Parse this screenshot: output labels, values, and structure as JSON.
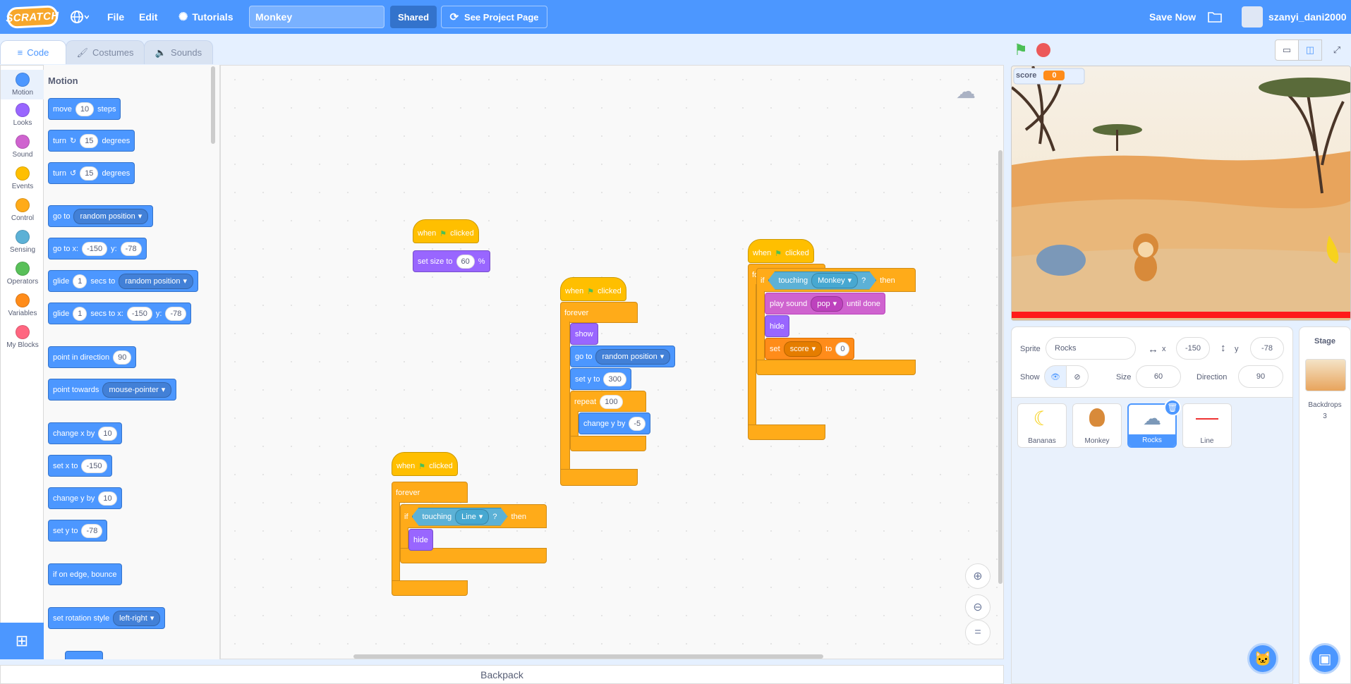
{
  "menu": {
    "logo": "SCRATCH",
    "file": "File",
    "edit": "Edit",
    "tutorials": "Tutorials",
    "project_title": "Monkey",
    "shared": "Shared",
    "see_project_page": "See Project Page",
    "save_now": "Save Now",
    "username": "szanyi_dani2000"
  },
  "tabs": {
    "code": "Code",
    "costumes": "Costumes",
    "sounds": "Sounds"
  },
  "categories": [
    {
      "label": "Motion",
      "color": "#4c97ff"
    },
    {
      "label": "Looks",
      "color": "#9966ff"
    },
    {
      "label": "Sound",
      "color": "#cf63cf"
    },
    {
      "label": "Events",
      "color": "#ffbf00"
    },
    {
      "label": "Control",
      "color": "#ffab19"
    },
    {
      "label": "Sensing",
      "color": "#5cb1d6"
    },
    {
      "label": "Operators",
      "color": "#59c059"
    },
    {
      "label": "Variables",
      "color": "#ff8c1a"
    },
    {
      "label": "My Blocks",
      "color": "#ff6680"
    }
  ],
  "palette": {
    "title": "Motion",
    "move": {
      "a": "move",
      "v": "10",
      "b": "steps"
    },
    "turn_r": {
      "a": "turn",
      "v": "15",
      "b": "degrees"
    },
    "turn_l": {
      "a": "turn",
      "v": "15",
      "b": "degrees"
    },
    "goto": {
      "a": "go to",
      "d": "random position"
    },
    "gotoxy": {
      "a": "go to x:",
      "x": "-150",
      "y_lbl": "y:",
      "y": "-78"
    },
    "glide1": {
      "a": "glide",
      "v": "1",
      "b": "secs to",
      "d": "random position"
    },
    "glide2": {
      "a": "glide",
      "v": "1",
      "b": "secs to x:",
      "x": "-150",
      "y_lbl": "y:",
      "y": "-78"
    },
    "point_dir": {
      "a": "point in direction",
      "v": "90"
    },
    "point_towards": {
      "a": "point towards",
      "d": "mouse-pointer"
    },
    "change_x": {
      "a": "change x by",
      "v": "10"
    },
    "set_x": {
      "a": "set x to",
      "v": "-150"
    },
    "change_y": {
      "a": "change y by",
      "v": "10"
    },
    "set_y": {
      "a": "set y to",
      "v": "-78"
    },
    "bounce": {
      "a": "if on edge, bounce"
    },
    "rotation": {
      "a": "set rotation style",
      "d": "left-right"
    }
  },
  "scripts": {
    "s1": {
      "when": "when",
      "clicked": "clicked",
      "setsize": "set size to",
      "size": "60",
      "pct": "%"
    },
    "s2": {
      "when": "when",
      "clicked": "clicked",
      "forever": "forever",
      "show": "show",
      "goto": "go to",
      "goto_d": "random position",
      "sety": "set y to",
      "sety_v": "300",
      "repeat": "repeat",
      "repeat_v": "100",
      "changey": "change y by",
      "changey_v": "-5"
    },
    "s3": {
      "when": "when",
      "clicked": "clicked",
      "forever": "forever",
      "if": "if",
      "touching": "touching",
      "touching_d": "Monkey",
      "q": "?",
      "then": "then",
      "playsound": "play sound",
      "sound_d": "pop",
      "until": "until done",
      "hide": "hide",
      "set": "set",
      "var_d": "score",
      "to": "to",
      "set_v": "0"
    },
    "s4": {
      "when": "when",
      "clicked": "clicked",
      "forever": "forever",
      "if": "if",
      "touching": "touching",
      "touching_d": "Line",
      "q": "?",
      "then": "then",
      "hide": "hide"
    }
  },
  "backpack": "Backpack",
  "stage": {
    "var_name": "score",
    "var_value": "0"
  },
  "sprite_info": {
    "sprite_label": "Sprite",
    "sprite_name": "Rocks",
    "x_label": "x",
    "x": "-150",
    "y_label": "y",
    "y": "-78",
    "show_label": "Show",
    "size_label": "Size",
    "size": "60",
    "direction_label": "Direction",
    "direction": "90"
  },
  "sprites": [
    "Bananas",
    "Monkey",
    "Rocks",
    "Line"
  ],
  "stage_panel": {
    "title": "Stage",
    "backdrops_label": "Backdrops",
    "backdrops_count": "3"
  }
}
